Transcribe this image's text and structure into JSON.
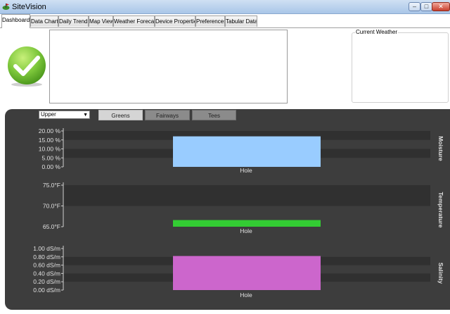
{
  "window": {
    "title": "SiteVision"
  },
  "tabs": [
    {
      "label": "Dashboard",
      "active": true
    },
    {
      "label": "Data Charts",
      "active": false
    },
    {
      "label": "Daily Trends",
      "active": false
    },
    {
      "label": "Map View",
      "active": false
    },
    {
      "label": "Weather Forecast",
      "active": false
    },
    {
      "label": "Device Properties",
      "active": false
    },
    {
      "label": "Preferences",
      "active": false
    },
    {
      "label": "Tabular Data",
      "active": false
    }
  ],
  "status": {
    "icon": "checkmark-icon",
    "color": "#7cc63a"
  },
  "current_weather": {
    "label": "Current Weather"
  },
  "controls": {
    "zone_selected": "Upper",
    "areas": [
      {
        "label": "Greens",
        "selected": true
      },
      {
        "label": "Fairways",
        "selected": false
      },
      {
        "label": "Tees",
        "selected": false
      }
    ]
  },
  "chart_data": [
    {
      "type": "bar",
      "title": "Moisture",
      "categories": [
        "Hole"
      ],
      "values": [
        17
      ],
      "ylim": [
        0,
        20
      ],
      "yticks": [
        "0.00 %",
        "5.00 %",
        "10.00 %",
        "15.00 %",
        "20.00 %"
      ],
      "color": "#99ccff",
      "xlabel": "Hole"
    },
    {
      "type": "bar",
      "title": "Temperature",
      "categories": [
        "Hole"
      ],
      "values": [
        66.6
      ],
      "ylim": [
        65,
        75
      ],
      "yticks": [
        "65.0°F",
        "70.0°F",
        "75.0°F"
      ],
      "color": "#33cc33",
      "xlabel": "Hole"
    },
    {
      "type": "bar",
      "title": "Salinity",
      "categories": [
        "Hole"
      ],
      "values": [
        0.82
      ],
      "ylim": [
        0,
        1
      ],
      "yticks": [
        "0.00 dS/m",
        "0.20 dS/m",
        "0.40 dS/m",
        "0.60 dS/m",
        "0.80 dS/m",
        "1.00 dS/m"
      ],
      "color": "#cc66cc",
      "xlabel": "Hole"
    }
  ]
}
